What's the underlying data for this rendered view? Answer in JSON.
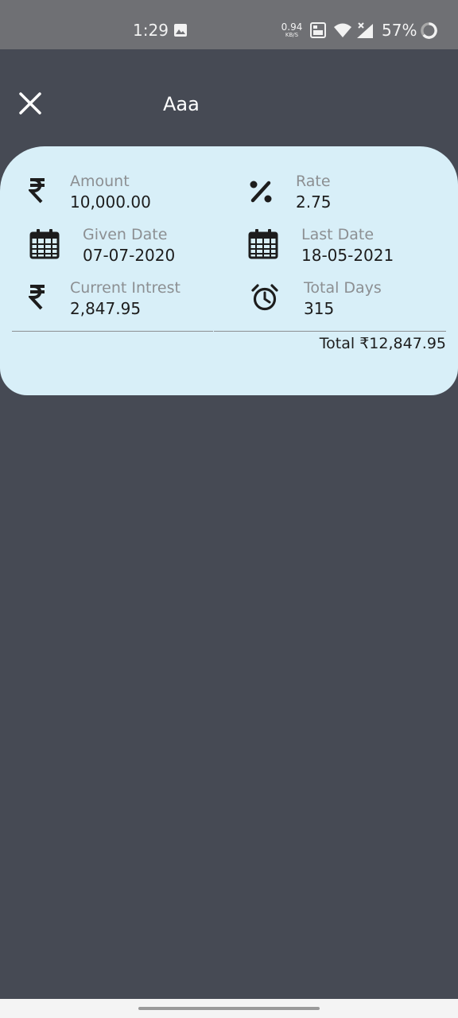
{
  "status_bar": {
    "time": "1:29",
    "net_speed": "0.94",
    "net_speed_unit": "KB/S",
    "battery": "57%",
    "icons": [
      "gallery-icon",
      "volte-icon",
      "wifi-icon",
      "signal-icon",
      "battery-icon"
    ]
  },
  "header": {
    "title": "Aaa",
    "close_icon": "close-icon"
  },
  "card": {
    "amount": {
      "label": "Amount",
      "value": "10,000.00",
      "icon": "rupee-icon"
    },
    "rate": {
      "label": "Rate",
      "value": "2.75",
      "icon": "percent-icon"
    },
    "given_date": {
      "label": "Given Date",
      "value": "07-07-2020",
      "icon": "calendar-icon"
    },
    "last_date": {
      "label": "Last Date",
      "value": "18-05-2021",
      "icon": "calendar-icon"
    },
    "current_interest": {
      "label": "Current Intrest",
      "value": "2,847.95",
      "icon": "rupee-icon"
    },
    "total_days": {
      "label": "Total Days",
      "value": "315",
      "icon": "alarm-clock-icon"
    },
    "total": "Total ₹12,847.95"
  },
  "colors": {
    "background": "#464a54",
    "status_bar": "#6f7074",
    "card": "#d8eff8",
    "label": "#8c8f92",
    "value": "#1d1d1d"
  }
}
